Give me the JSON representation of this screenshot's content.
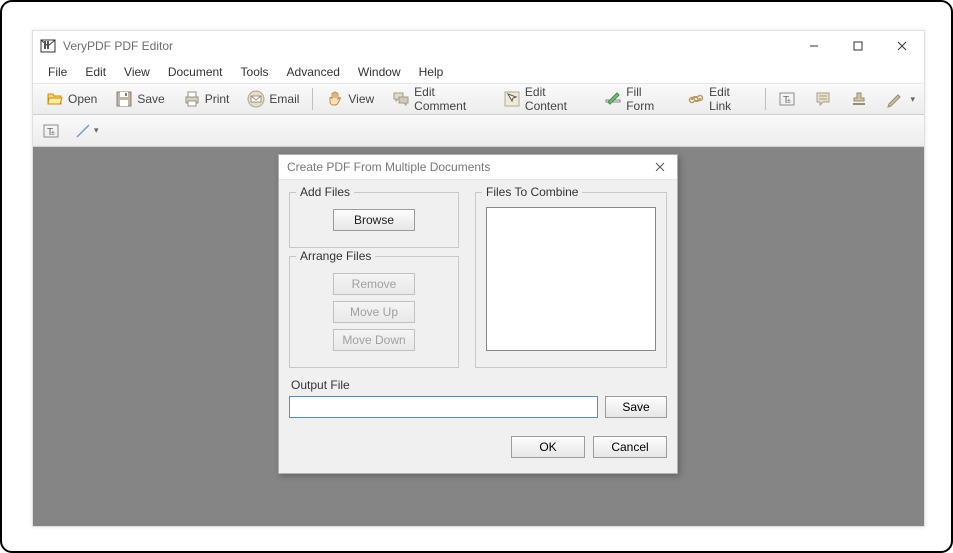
{
  "app": {
    "title": "VeryPDF PDF Editor"
  },
  "menu": {
    "items": [
      "File",
      "Edit",
      "View",
      "Document",
      "Tools",
      "Advanced",
      "Window",
      "Help"
    ]
  },
  "toolbar": {
    "open": "Open",
    "save": "Save",
    "print": "Print",
    "email": "Email",
    "view": "View",
    "edit_comment": "Edit Comment",
    "edit_content": "Edit Content",
    "fill_form": "Fill Form",
    "edit_link": "Edit Link"
  },
  "dialog": {
    "title": "Create PDF From Multiple Documents",
    "add_files": {
      "legend": "Add Files",
      "browse": "Browse"
    },
    "arrange_files": {
      "legend": "Arrange Files",
      "remove": "Remove",
      "move_up": "Move Up",
      "move_down": "Move Down"
    },
    "files_to_combine": {
      "legend": "Files To Combine"
    },
    "output": {
      "label": "Output File",
      "value": "",
      "save": "Save"
    },
    "ok": "OK",
    "cancel": "Cancel"
  }
}
